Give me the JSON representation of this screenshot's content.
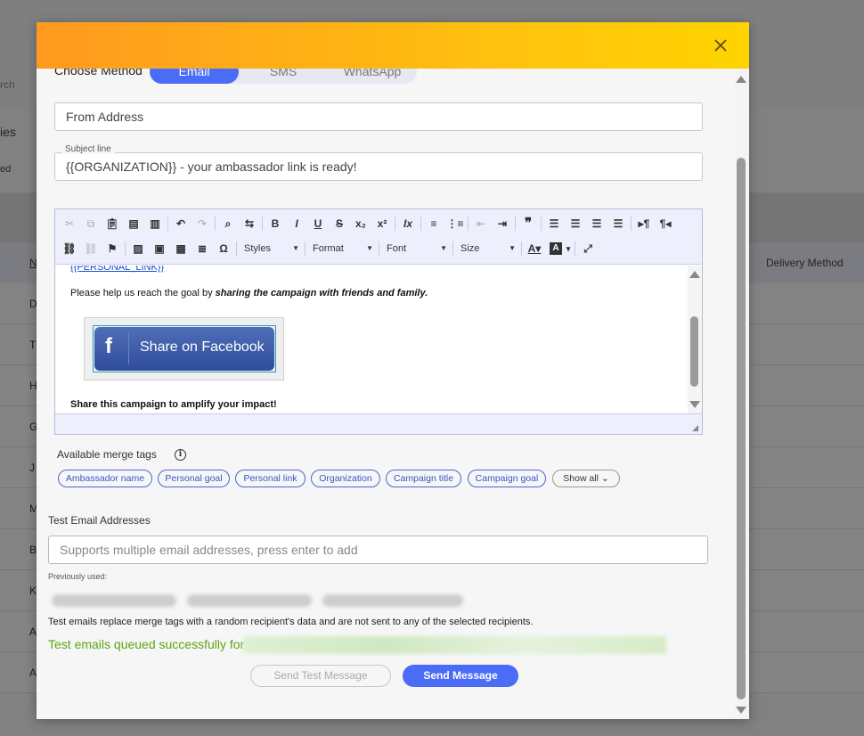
{
  "background": {
    "search_fragment": "rch",
    "sidebar_fragment": "ies",
    "sidebar_fragment2": "ed",
    "column_n": "N",
    "column_delivery": "Delivery Method",
    "row_initials": [
      "D",
      "T",
      "H",
      "G",
      "J",
      "M",
      "B",
      "K",
      "A",
      "A"
    ]
  },
  "modal": {
    "close_icon": "close-icon",
    "choose_method_label": "Choose Method",
    "methods": [
      {
        "label": "Email",
        "active": true
      },
      {
        "label": "SMS",
        "active": false
      },
      {
        "label": "WhatsApp",
        "active": false
      }
    ],
    "from_address_placeholder": "From Address",
    "subject_label": "Subject line",
    "subject_value": "{{ORGANIZATION}} - your ambassador link is ready!"
  },
  "editor": {
    "toolbar_row1": [
      "cut-icon",
      "copy-icon",
      "paste-icon",
      "paste-text-icon",
      "paste-word-icon",
      "undo-icon",
      "redo-icon",
      "find-icon",
      "replace-icon",
      "bold-icon",
      "italic-icon",
      "underline-icon",
      "strike-icon",
      "subscript-icon",
      "superscript-icon",
      "remove-format-icon",
      "numbered-list-icon",
      "bulleted-list-icon",
      "outdent-icon",
      "indent-icon",
      "blockquote-icon",
      "align-left-icon",
      "align-center-icon",
      "align-right-icon",
      "justify-icon",
      "ltr-icon",
      "rtl-icon"
    ],
    "toolbar_row2_icons": [
      "link-icon",
      "unlink-icon",
      "anchor-icon",
      "image-icon",
      "template-icon",
      "table-icon",
      "horizontal-line-icon",
      "special-char-icon"
    ],
    "selects": [
      "Styles",
      "Format",
      "Font",
      "Size"
    ],
    "merge_link_text": "{{PERSONAL_LINK}}",
    "para1_text": "Please help us reach the goal by ",
    "para1_bold": "sharing the campaign with friends and family.",
    "fb_button_label": "Share on Facebook",
    "para2_text": "Share this campaign to amplify your impact!"
  },
  "merge_tags": {
    "title": "Available merge tags",
    "tags": [
      "Ambassador name",
      "Personal goal",
      "Personal link",
      "Organization",
      "Campaign title",
      "Campaign goal"
    ],
    "show_all": "Show all"
  },
  "test": {
    "title": "Test Email Addresses",
    "placeholder": "Supports multiple email addresses, press enter to add",
    "previously_used": "Previously used:",
    "note": "Test emails replace merge tags with a random recipient's data and are not sent to any of the selected recipients.",
    "success": "Test emails queued successfully for"
  },
  "buttons": {
    "send_test": "Send Test Message",
    "send": "Send Message"
  }
}
